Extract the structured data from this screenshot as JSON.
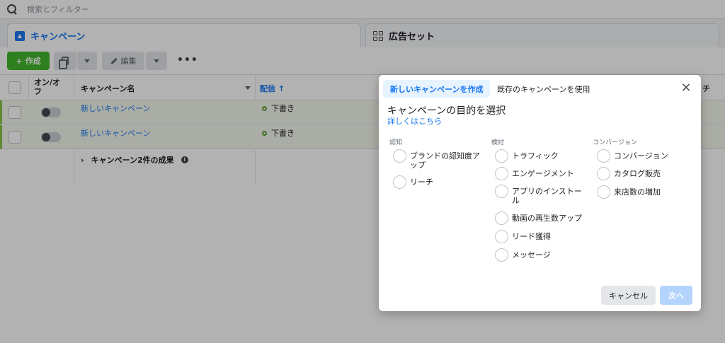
{
  "search": {
    "placeholder": "検索とフィルター"
  },
  "tabs": [
    {
      "label": "キャンペーン",
      "icon": "campaign-icon"
    },
    {
      "label": "広告セット",
      "icon": "grid-icon"
    }
  ],
  "toolbar": {
    "create_label": "作成",
    "edit_label": "編集",
    "more_label": "•••"
  },
  "table": {
    "columns": {
      "onoff": "オン/オフ",
      "name": "キャンペーン名",
      "delivery": "配信 ↑",
      "last_partial": "チ"
    },
    "rows": [
      {
        "name": "新しいキャンペーン",
        "delivery": "下書き"
      },
      {
        "name": "新しいキャンペーン",
        "delivery": "下書き"
      }
    ],
    "summary": "キャンペーン2件の成果"
  },
  "dialog": {
    "tab_new": "新しいキャンペーンを作成",
    "tab_existing": "既存のキャンペーンを使用",
    "close": "×",
    "title": "キャンペーンの目的を選択",
    "learn_more": "詳しくはこちら",
    "columns": [
      {
        "heading": "認知",
        "options": [
          "ブランドの認知度アップ",
          "リーチ"
        ]
      },
      {
        "heading": "検討",
        "options": [
          "トラフィック",
          "エンゲージメント",
          "アプリのインストール",
          "動画の再生数アップ",
          "リード獲得",
          "メッセージ"
        ]
      },
      {
        "heading": "コンバージョン",
        "options": [
          "コンバージョン",
          "カタログ販売",
          "来店数の増加"
        ]
      }
    ],
    "cancel_label": "キャンセル",
    "next_label": "次へ"
  },
  "colors": {
    "accent": "#1877f2",
    "create_green": "#42b72a",
    "next_disabled": "#b3d4fc"
  }
}
